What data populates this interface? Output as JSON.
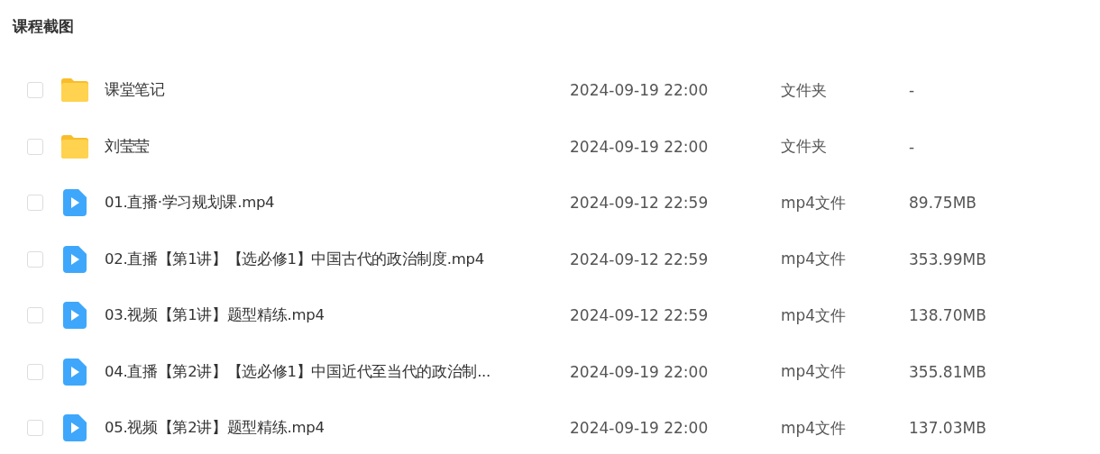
{
  "title": "课程截图",
  "files": [
    {
      "kind": "folder",
      "checked": false,
      "name": "课堂笔记",
      "modified": "2024-09-19 22:00",
      "type": "文件夹",
      "size": "-"
    },
    {
      "kind": "folder",
      "checked": false,
      "name": "刘莹莹",
      "modified": "2024-09-19 22:00",
      "type": "文件夹",
      "size": "-"
    },
    {
      "kind": "video",
      "checked": false,
      "name": "01.直播·学习规划课.mp4",
      "modified": "2024-09-12 22:59",
      "type": "mp4文件",
      "size": "89.75MB"
    },
    {
      "kind": "video",
      "checked": false,
      "name": "02.直播【第1讲】【选必修1】中国古代的政治制度.mp4",
      "modified": "2024-09-12 22:59",
      "type": "mp4文件",
      "size": "353.99MB"
    },
    {
      "kind": "video",
      "checked": false,
      "name": "03.视频【第1讲】题型精练.mp4",
      "modified": "2024-09-12 22:59",
      "type": "mp4文件",
      "size": "138.70MB"
    },
    {
      "kind": "video",
      "checked": false,
      "name": "04.直播【第2讲】【选必修1】中国近代至当代的政治制...",
      "modified": "2024-09-19 22:00",
      "type": "mp4文件",
      "size": "355.81MB"
    },
    {
      "kind": "video",
      "checked": false,
      "name": "05.视频【第2讲】题型精练.mp4",
      "modified": "2024-09-19 22:00",
      "type": "mp4文件",
      "size": "137.03MB"
    }
  ]
}
